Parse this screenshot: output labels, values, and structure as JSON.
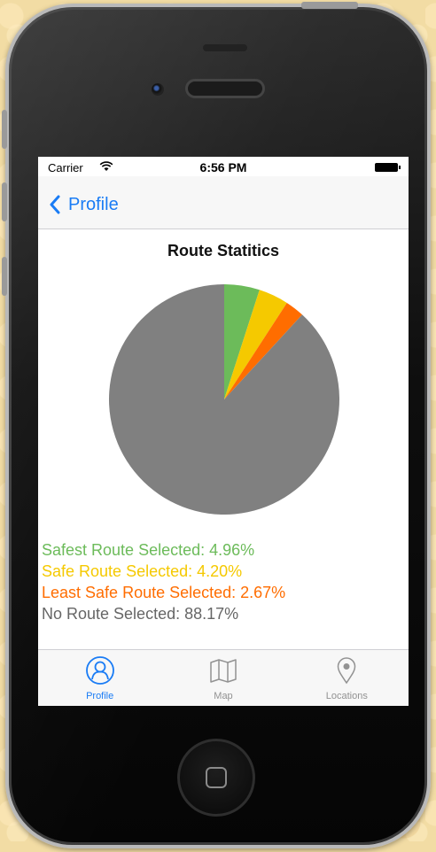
{
  "status_bar": {
    "carrier": "Carrier",
    "time": "6:56 PM"
  },
  "nav": {
    "back_label": "Profile"
  },
  "chart_title": "Route Statitics",
  "chart_data": {
    "type": "pie",
    "title": "Route Statitics",
    "slices": [
      {
        "label": "Safest Route Selected",
        "value": 4.96,
        "color": "#6cbb5a"
      },
      {
        "label": "Safe Route Selected",
        "value": 4.2,
        "color": "#f5c900"
      },
      {
        "label": "Least Safe Route Selected",
        "value": 2.67,
        "color": "#ff6d00"
      },
      {
        "label": "No Route Selected",
        "value": 88.17,
        "color": "#808080"
      }
    ]
  },
  "legend": [
    {
      "text": "Safest Route Selected: 4.96%",
      "color": "#6cbb5a"
    },
    {
      "text": "Safe Route Selected: 4.20%",
      "color": "#f5c900"
    },
    {
      "text": "Least Safe Route Selected: 2.67%",
      "color": "#ff6d00"
    },
    {
      "text": "No Route Selected: 88.17%",
      "color": "#666666"
    }
  ],
  "tabs": [
    {
      "label": "Profile",
      "icon": "profile-icon",
      "active": true
    },
    {
      "label": "Map",
      "icon": "map-icon",
      "active": false
    },
    {
      "label": "Locations",
      "icon": "location-pin-icon",
      "active": false
    }
  ],
  "colors": {
    "accent": "#1a7cf5",
    "inactive": "#929292"
  }
}
